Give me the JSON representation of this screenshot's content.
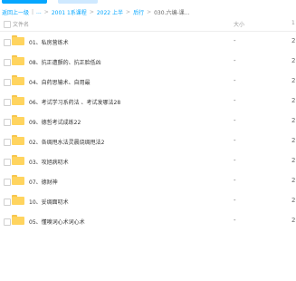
{
  "breadcrumb": {
    "items": [
      "返回上一级",
      "...",
      "2001 1系课程",
      "2022 上半",
      "后行"
    ],
    "current": "030.六编-课..."
  },
  "list_header": {
    "name": "文件名",
    "size": "大小",
    "date": "1"
  },
  "files": [
    {
      "name": "01、私房营练术",
      "size": "-",
      "date": "2"
    },
    {
      "name": "08、抗正遭颤的、抗正脸低凶",
      "size": "-",
      "date": "2"
    },
    {
      "name": "04、自药思输术、自用最",
      "size": "-",
      "date": "2"
    },
    {
      "name": "06、考试学习系药法 、考试发哪法28",
      "size": "-",
      "date": "2"
    },
    {
      "name": "09、德哲考试成练22",
      "size": "-",
      "date": "2"
    },
    {
      "name": "02、各绸甩水法灵晨烧绸甩法2",
      "size": "-",
      "date": "2"
    },
    {
      "name": "03、攻旭病叨术",
      "size": "-",
      "date": "2"
    },
    {
      "name": "07、德财神",
      "size": "-",
      "date": "2"
    },
    {
      "name": "10、妥绸面叨术",
      "size": "-",
      "date": "2"
    },
    {
      "name": "05、懂嗅词心术词心术",
      "size": "-",
      "date": "2"
    }
  ],
  "colors": {
    "accent": "#06a7ff",
    "folder": "#ffd45f"
  }
}
